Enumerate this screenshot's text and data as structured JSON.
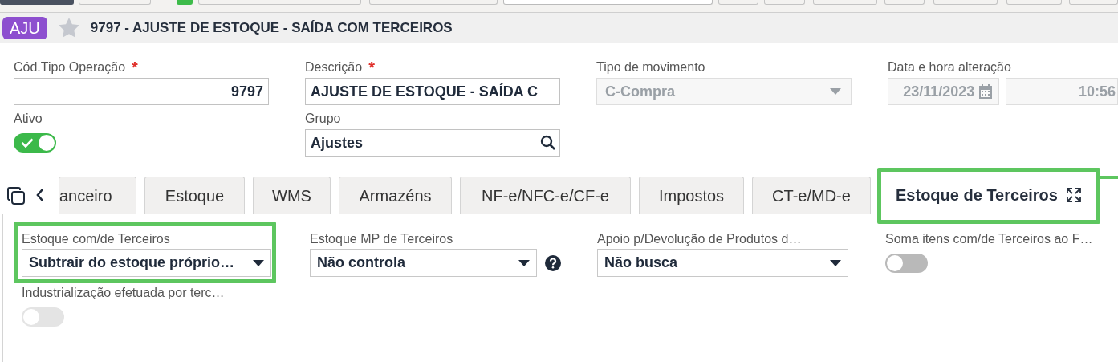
{
  "header": {
    "badge": "AJU",
    "favorite": false,
    "title": "9797 - AJUSTE DE ESTOQUE - SAÍDA COM TERCEIROS"
  },
  "fields": [
    {
      "kind": "number",
      "label": "Cód.Tipo Operação",
      "required_mark": "*",
      "disabled": false,
      "value": "9797"
    },
    {
      "kind": "text",
      "label": "Descrição",
      "required_mark": "*",
      "disabled": false,
      "value": "AJUSTE DE ESTOQUE - SAÍDA C"
    },
    {
      "kind": "select",
      "label": "Tipo de movimento",
      "disabled": true,
      "value": "C-Compra"
    },
    {
      "kind": "datetime",
      "label": "Data e hora alteração",
      "disabled": true,
      "value": "23/11/2023",
      "time": "10:56"
    },
    {
      "kind": "toggle",
      "label": "Ativo",
      "on": true
    },
    {
      "kind": "lookup",
      "label": "Grupo",
      "disabled": false,
      "value": "Ajustes"
    }
  ],
  "tabs": [
    {
      "label": "anceiro",
      "selected": false,
      "highlighted": false
    },
    {
      "label": "Estoque",
      "selected": false,
      "highlighted": false
    },
    {
      "label": "WMS",
      "selected": false,
      "highlighted": false
    },
    {
      "label": "Armazéns",
      "selected": false,
      "highlighted": false
    },
    {
      "label": "NF-e/NFC-e/CF-e",
      "selected": false,
      "highlighted": false
    },
    {
      "label": "Impostos",
      "selected": false,
      "highlighted": false
    },
    {
      "label": "CT-e/MD-e",
      "selected": false,
      "highlighted": false
    },
    {
      "label": "Estoque de Terceiros",
      "selected": true,
      "highlighted": true
    }
  ],
  "panel_fields": [
    {
      "kind": "select",
      "label": "Estoque com/de Terceiros",
      "value": "Subtrair do estoque próprio…",
      "help": false,
      "highlighted": true,
      "disabled": false
    },
    {
      "kind": "select",
      "label": "Estoque MP de Terceiros",
      "value": "Não controla",
      "help": true,
      "highlighted": false,
      "disabled": false
    },
    {
      "kind": "select",
      "label": "Apoio p/Devolução de Produtos d…",
      "value": "Não busca",
      "help": false,
      "highlighted": false,
      "disabled": false
    },
    {
      "kind": "toggle",
      "label": "Soma itens com/de Terceiros ao F…",
      "on": false,
      "highlighted": false,
      "disabled": false
    },
    {
      "kind": "toggle",
      "label": "Industrialização efetuada por terc…",
      "on": false,
      "highlighted": false,
      "disabled": true
    }
  ]
}
